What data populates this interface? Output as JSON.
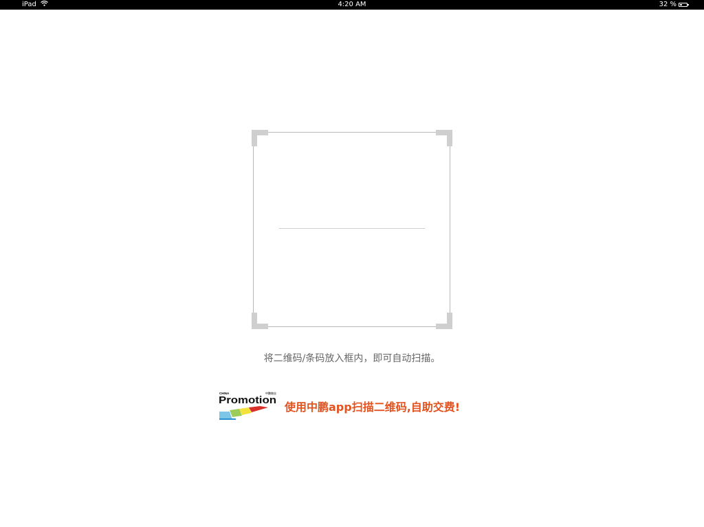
{
  "status_bar": {
    "device": "iPad",
    "time": "4:20 AM",
    "battery_text": "32 %",
    "battery_level": 0.32
  },
  "scanner": {
    "instruction": "将二维码/条码放入框内，即可自动扫描。"
  },
  "promo": {
    "logo_small_top": "CHINA",
    "logo_small_right": "中鹏物业",
    "logo_word": "Promotion",
    "message": "使用中鹏app扫描二维码,自助交费!"
  },
  "colors": {
    "promo_text": "#e2531f",
    "frame_border": "#b8b8b8",
    "corner": "#cfcfcf"
  }
}
